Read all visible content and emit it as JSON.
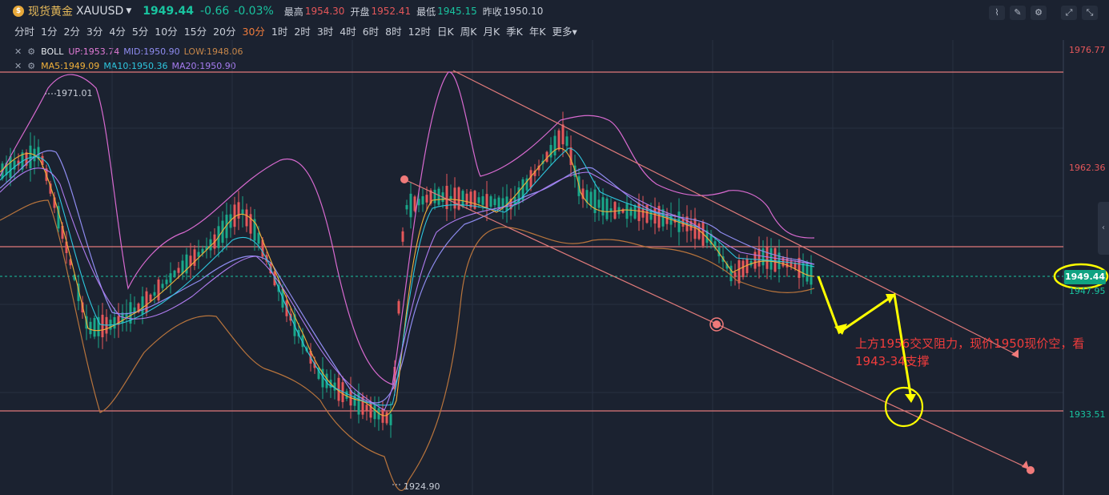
{
  "header": {
    "coin_glyph": "$",
    "title": "现货黄金",
    "symbol": "XAUUSD",
    "price": "1949.44",
    "change": "-0.66",
    "change_pct": "-0.03%",
    "high_label": "最高",
    "high": "1954.30",
    "open_label": "开盘",
    "open": "1952.41",
    "low_label": "最低",
    "low": "1945.15",
    "prev_label": "昨收",
    "prev": "1950.10"
  },
  "toolbar_icons": [
    "chart-type-icon",
    "draw-icon",
    "settings-icon",
    "fullscreen-icon",
    "restore-icon"
  ],
  "timeframes": [
    "分时",
    "1分",
    "2分",
    "3分",
    "4分",
    "5分",
    "10分",
    "15分",
    "20分",
    "30分",
    "1时",
    "2时",
    "3时",
    "4时",
    "6时",
    "8时",
    "12时",
    "日K",
    "周K",
    "月K",
    "季K",
    "年K",
    "更多"
  ],
  "active_timeframe": "30分",
  "indicators": {
    "boll": {
      "name": "BOLL",
      "up": "UP:1953.74",
      "mid": "MID:1950.90",
      "low": "LOW:1948.06"
    },
    "ma": {
      "ma5": "MA5:1949.09",
      "ma10": "MA10:1950.36",
      "ma20": "MA20:1950.90"
    }
  },
  "axis_labels": {
    "top": "1976.77",
    "mid": "1962.36",
    "current": "1949.44",
    "below_current": "1947.95",
    "bottom": "1933.51"
  },
  "marks": {
    "high": "1971.01",
    "low": "1924.90"
  },
  "annotation": {
    "line1": "上方1956交叉阻力，现价1950现价空，看",
    "line2": "1943-34支撑"
  },
  "colors": {
    "bg": "#1b2230",
    "up": "#e5575a",
    "down": "#19c4a0",
    "annotation": "#f03c3c",
    "highlight": "#ffff00"
  }
}
